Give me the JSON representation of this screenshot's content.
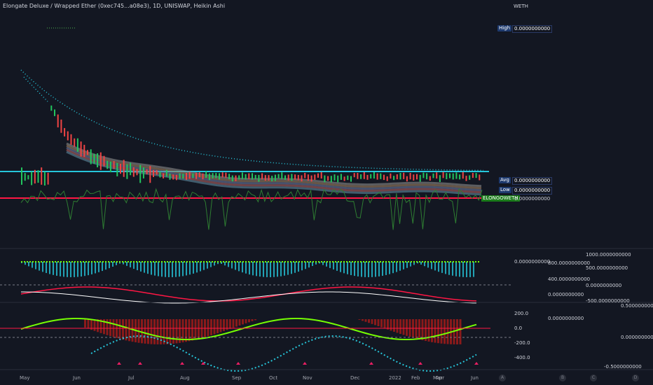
{
  "header": {
    "title": "Elongate Deluxe / Wrapped Ether (0xec745...a08e3), 1D, UNISWAP, Heikin Ashi",
    "currency": "WETH"
  },
  "price_tags": {
    "high_label": "High",
    "high_value": "0.0000000000",
    "avg_label": "Avg",
    "avg_value": "0.0000000000",
    "low_label": "Low",
    "low_value": "0.0000000000",
    "symbol_label": "ELONGOWETH",
    "symbol_value": "0.0000000000"
  },
  "pane_values": {
    "osc1_value": "0.0000000000",
    "osc1_axis": [
      "1000.0000000000",
      "800.0000000000",
      "500.0000000000",
      "400.0000000000",
      "0.0000000000",
      "0.0000000000",
      "-500.0000000000"
    ],
    "osc2_axis": [
      "200.0",
      "0.0",
      "-200.0",
      "-400.0"
    ],
    "osc2_value": "0.0000000000",
    "osc3_axis": [
      "0.5000000000",
      "0.0000000000",
      "-0.5000000000"
    ]
  },
  "xaxis": {
    "labels": [
      "May",
      "Jun",
      "Jul",
      "Aug",
      "Sep",
      "Oct",
      "Nov",
      "Dec",
      "2022",
      "Feb",
      "Mar",
      "Apr",
      "Jun"
    ],
    "circles": [
      "A",
      "B",
      "C",
      "D"
    ]
  },
  "chart_data": {
    "type": "line",
    "style": "Heikin Ashi",
    "exchange": "UNISWAP",
    "interval": "1D",
    "x": [
      "May",
      "Jun",
      "Jul",
      "Aug",
      "Sep",
      "Oct",
      "Nov",
      "Dec",
      "2022",
      "Feb",
      "Mar",
      "Apr",
      "Jun"
    ],
    "series": [
      {
        "values": [
          0.0,
          0.0,
          0.0,
          0.0,
          0.0,
          0.0,
          0.0,
          0.0,
          0.0,
          0.0,
          0.0,
          0.0,
          0.0
        ]
      }
    ],
    "oscillator_ticks": [
      200.0,
      0.0,
      -200.0,
      -400.0
    ],
    "colors": {
      "background": "#131722",
      "up": "#22c55e",
      "down": "#ef4444",
      "teal": "#26c6da",
      "red_line": "#ff1744",
      "green_line": "#76ff03"
    }
  }
}
